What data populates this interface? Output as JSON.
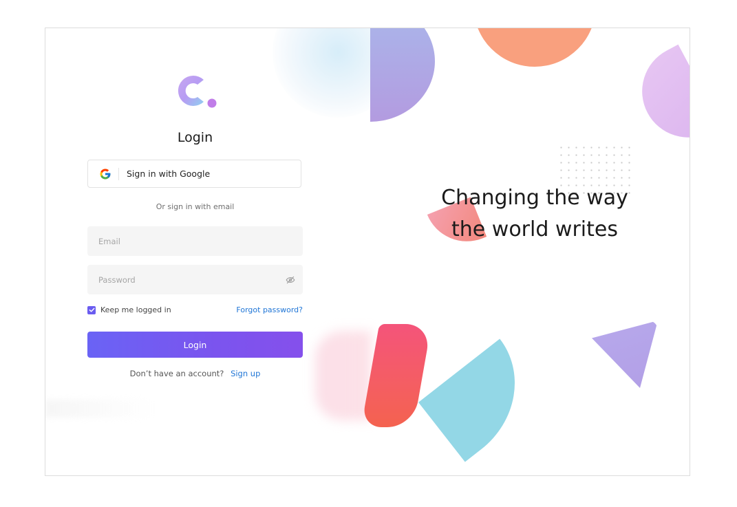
{
  "login": {
    "title": "Login",
    "google_label": "Sign in with Google",
    "divider_text": "Or sign in with email",
    "email_placeholder": "Email",
    "email_value": "",
    "password_placeholder": "Password",
    "password_value": "",
    "remember_label": "Keep me logged in",
    "remember_checked": true,
    "forgot_label": "Forgot password?",
    "submit_label": "Login",
    "signup_prompt": "Don’t have an account?",
    "signup_link": "Sign up"
  },
  "hero": {
    "tagline_line1": "Changing the way",
    "tagline_line2": "the world writes"
  },
  "colors": {
    "accent": "#6a5cf0",
    "link": "#1f75d6",
    "button_gradient_start": "#6a63f5",
    "button_gradient_end": "#8550ec"
  },
  "icons": {
    "logo": "c-dot-logo",
    "google": "google-g-icon",
    "password_toggle": "eye-off-icon",
    "checkbox": "check-icon"
  }
}
